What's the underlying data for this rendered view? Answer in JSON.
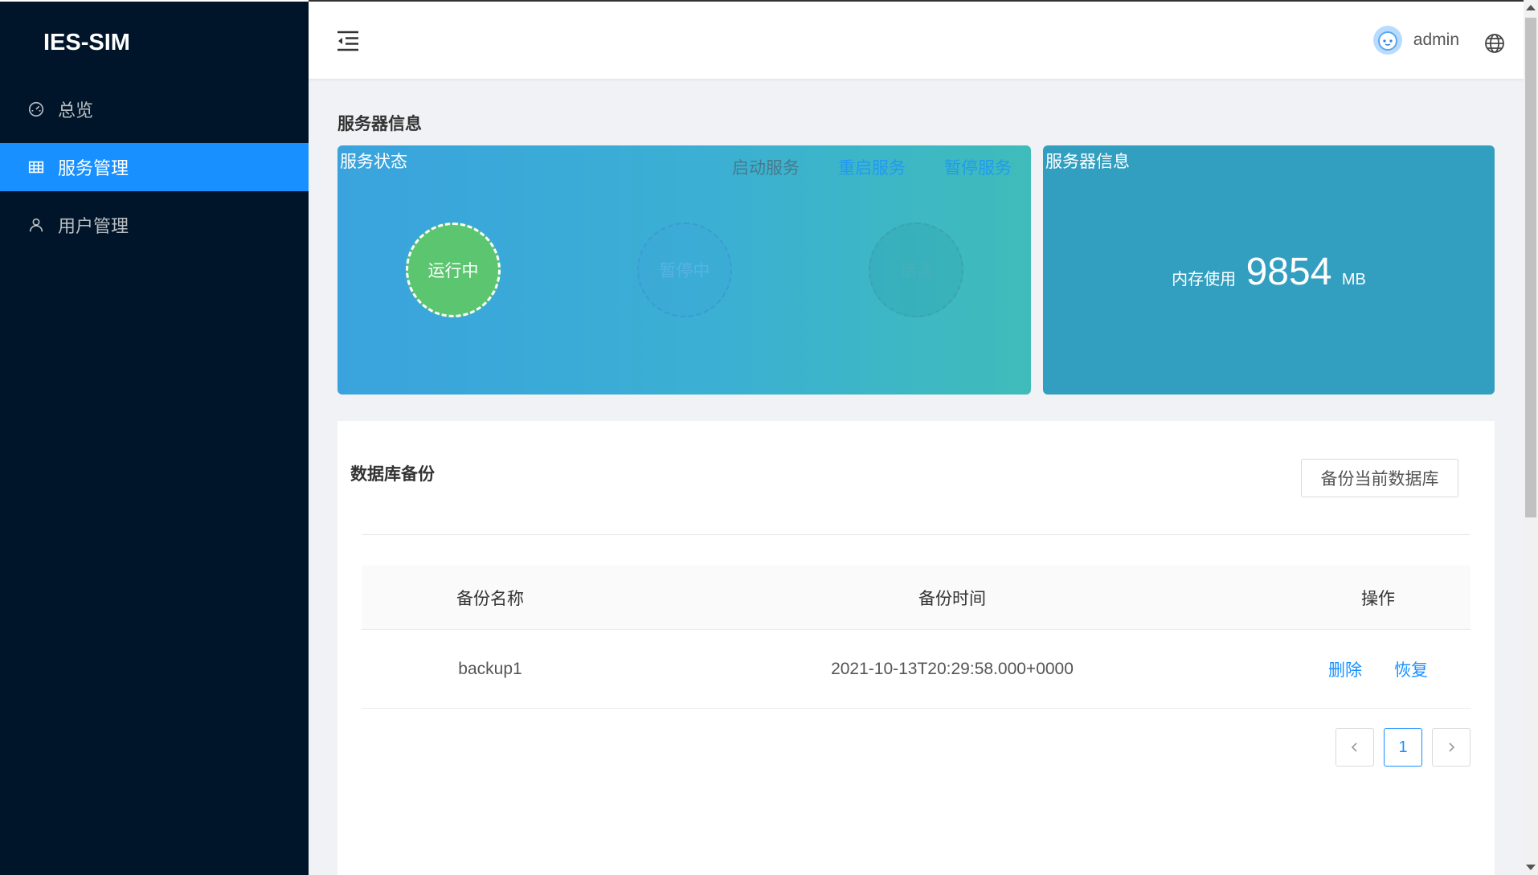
{
  "app": {
    "title": "IES-SIM"
  },
  "sidebar": {
    "items": [
      {
        "label": "总览",
        "icon": "dashboard-icon",
        "active": false
      },
      {
        "label": "服务管理",
        "icon": "table-icon",
        "active": true
      },
      {
        "label": "用户管理",
        "icon": "user-icon",
        "active": false
      }
    ]
  },
  "header": {
    "username": "admin"
  },
  "server": {
    "section_title": "服务器信息",
    "status_card": {
      "title": "服务状态",
      "actions": {
        "start": "启动服务",
        "restart": "重启服务",
        "stop": "暂停服务"
      },
      "states": {
        "running": "运行中",
        "paused": "暂停中",
        "error": "错误"
      }
    },
    "info_card": {
      "title": "服务器信息",
      "memory_label": "内存使用",
      "memory_value": "9854",
      "memory_unit": "MB"
    }
  },
  "backup": {
    "title": "数据库备份",
    "button_label": "备份当前数据库",
    "columns": {
      "name": "备份名称",
      "time": "备份时间",
      "op": "操作"
    },
    "rows": [
      {
        "name": "backup1",
        "time": "2021-10-13T20:29:58.000+0000",
        "delete": "删除",
        "restore": "恢复"
      }
    ],
    "pagination": {
      "current": "1"
    }
  },
  "colors": {
    "sidebar_bg": "#001529",
    "accent": "#1890ff",
    "running": "#5cc56f"
  }
}
